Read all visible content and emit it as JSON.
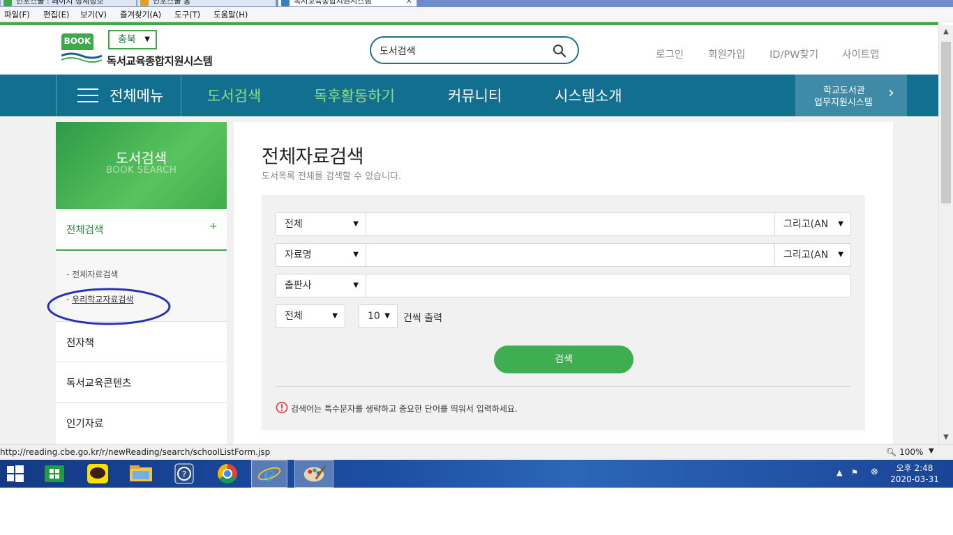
{
  "browser": {
    "tabs": [
      {
        "label": "인포스쿨 : 페이지 상세정보"
      },
      {
        "label": "인포스쿨 홈"
      },
      {
        "label": "독서교육종합지원시스템"
      }
    ],
    "menu": [
      "파일(F)",
      "편집(E)",
      "보기(V)",
      "즐겨찾기(A)",
      "도구(T)",
      "도움말(H)"
    ],
    "status_url": "http://reading.cbe.go.kr/r/newReading/search/schoolListForm.jsp",
    "zoom": "100%"
  },
  "header": {
    "logo_text": "BOOK",
    "region": "충북",
    "site_title": "독서교육종합지원시스템",
    "search_value": "도서검색",
    "links": [
      "로그인",
      "회원가입",
      "ID/PW찾기",
      "사이트맵"
    ]
  },
  "nav": {
    "all_menu": "전체메뉴",
    "items": [
      "도서검색",
      "독후활동하기",
      "커뮤니티",
      "시스템소개"
    ],
    "side_line1": "학교도서관",
    "side_line2": "업무지원시스템",
    "accent": "#136f8f",
    "active_color": "#8ee07c"
  },
  "sidebar": {
    "banner_title": "도서검색",
    "banner_sub": "BOOK SEARCH",
    "active_item": "전체검색",
    "active_toggle": "+",
    "sub_items": [
      "전체자료검색",
      "우리학교자료검색"
    ],
    "items": [
      "전자책",
      "독서교육콘텐츠",
      "인기자료"
    ]
  },
  "main": {
    "title": "전체자료검색",
    "subtitle": "도서목록 전체를 검색할 수 있습니다.",
    "rows": [
      {
        "field": "전체",
        "operator": "그리고(AN"
      },
      {
        "field": "자료명",
        "operator": "그리고(AN"
      },
      {
        "field": "출판사"
      }
    ],
    "scope": "전체",
    "per_page": "10",
    "per_page_suffix": "건씩 출력",
    "search_button": "검색",
    "notice": "검색어는 특수문자를 생략하고 중요한 단어를 띄워서 입력하세요.",
    "brand_green": "#3ea84a"
  },
  "taskbar": {
    "time": "오후 2:48",
    "date": "2020-03-31"
  }
}
